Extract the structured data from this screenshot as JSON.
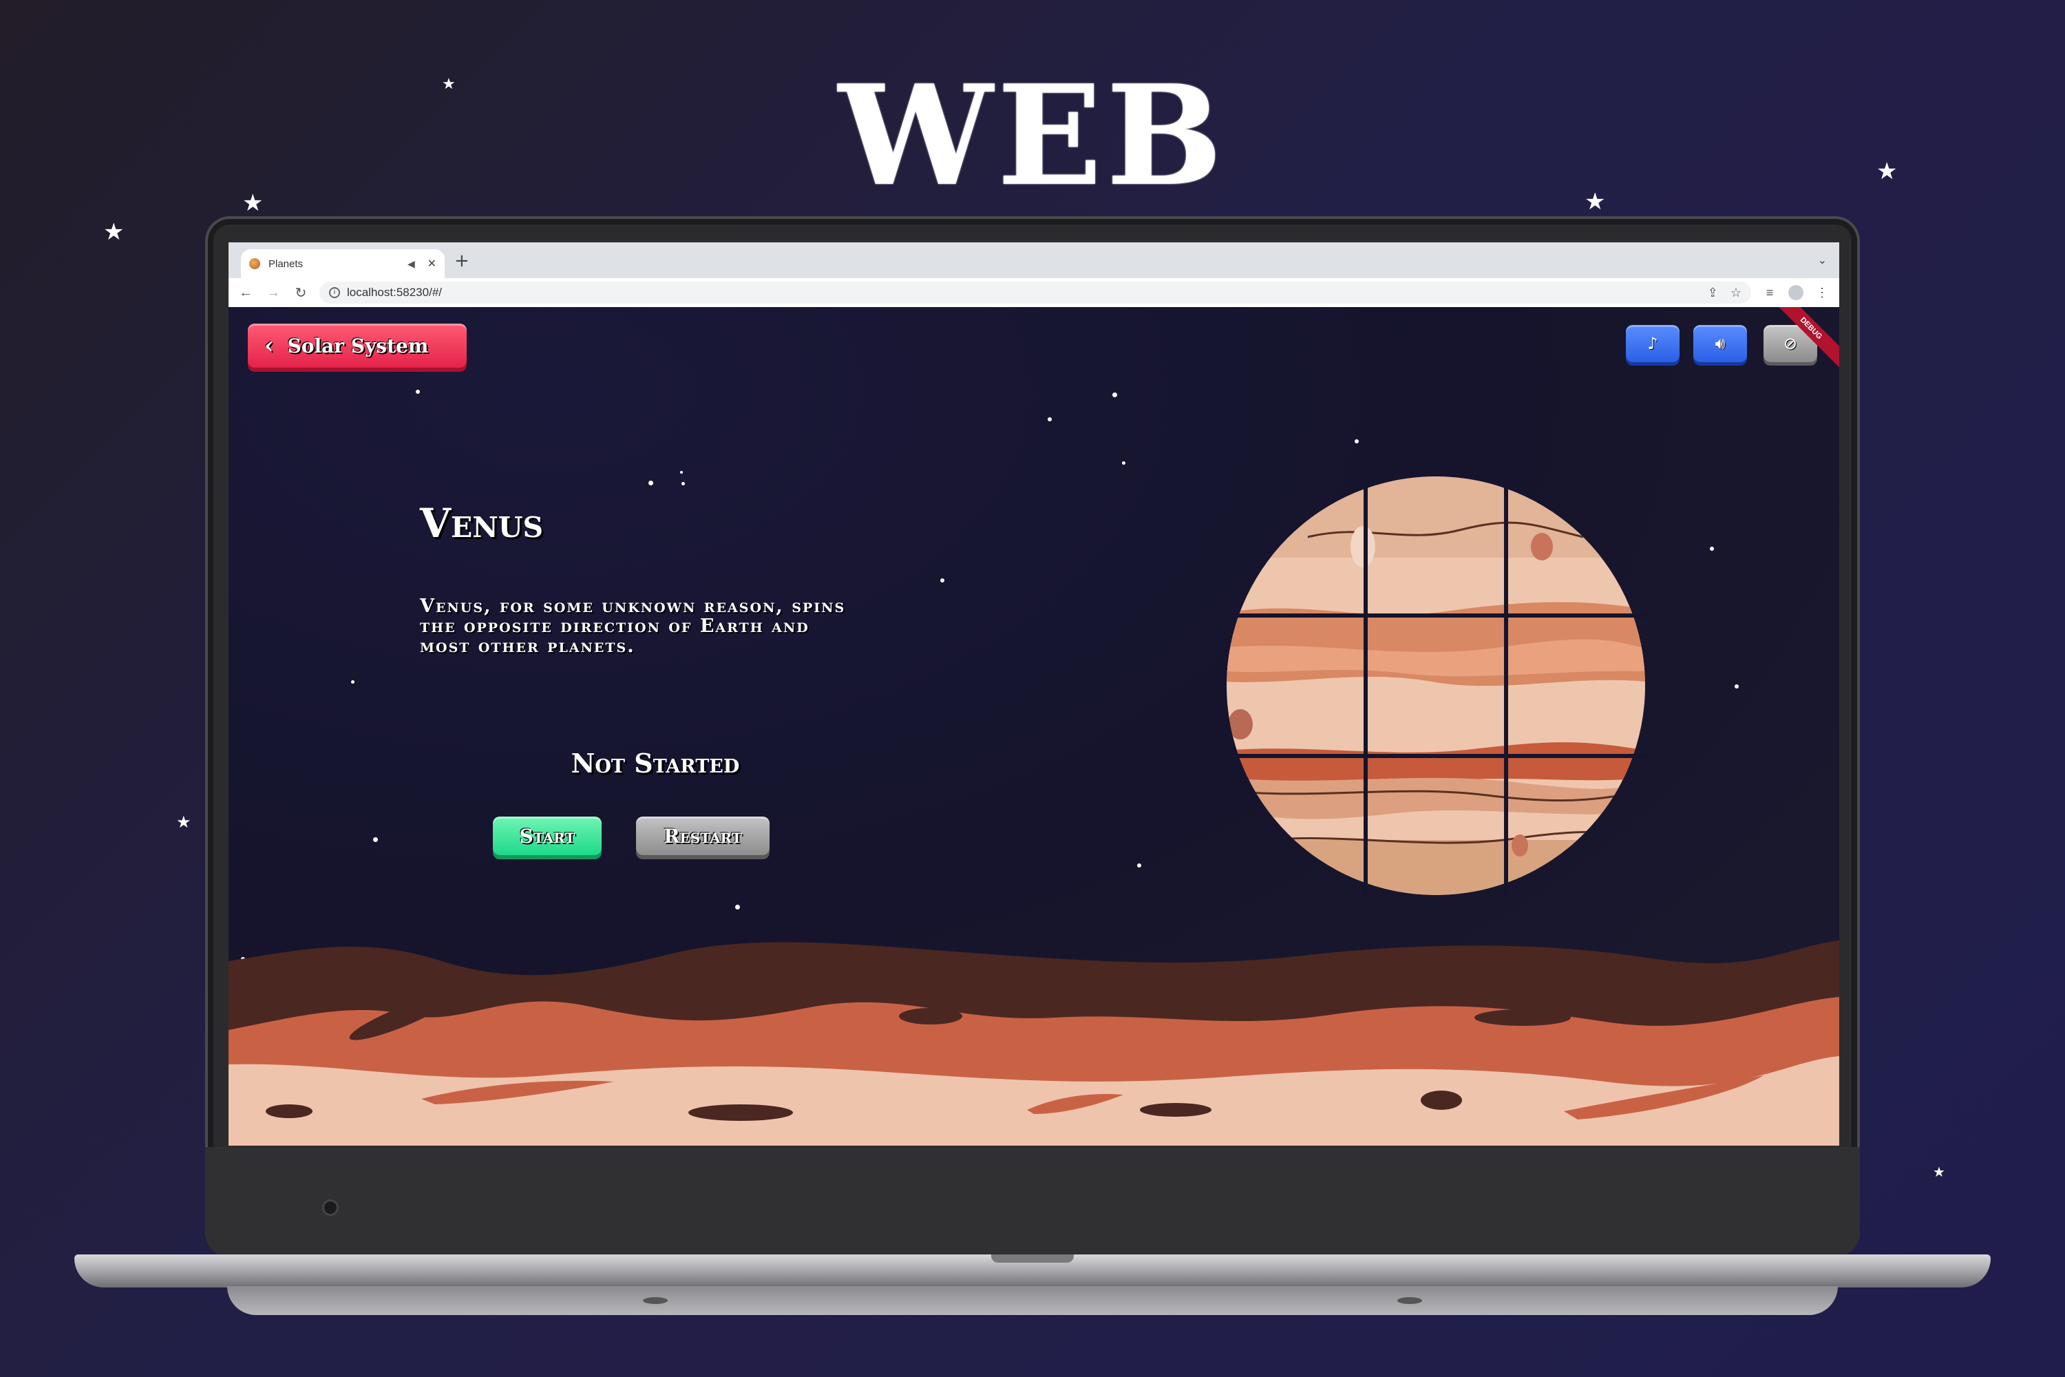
{
  "headline": "WEB",
  "browser": {
    "tab_title": "Planets",
    "new_tab": "+",
    "url": "localhost:58230/#/"
  },
  "app": {
    "back_button_label": "Solar System",
    "debug_banner": "DEBUG",
    "planet_name": "Venus",
    "planet_description": "Venus, for some unknown reason, spins the opposite direction of Earth and most other planets.",
    "status": "Not Started",
    "start_label": "Start",
    "restart_label": "Restart"
  },
  "icons": {
    "music": "music-note-icon",
    "sound": "speaker-icon",
    "hide": "eye-off-icon"
  },
  "colors": {
    "back_button": "#e4234a",
    "start_button": "#1ed98a",
    "restart_button": "#8d8d8d",
    "toggle_buttons": "#2a5fe6",
    "sky": "#15142c",
    "ground_dark": "#4b2722",
    "ground_mid": "#c96245",
    "ground_light": "#efc4ad"
  }
}
